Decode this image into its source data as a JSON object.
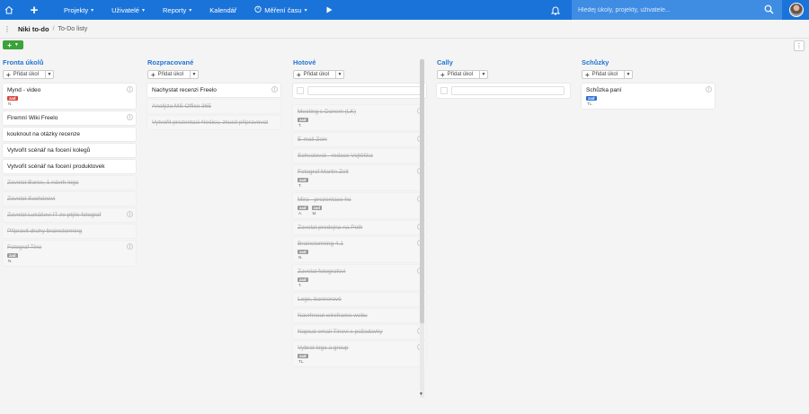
{
  "topbar": {
    "nav": [
      {
        "label": "Projekty",
        "dropdown": true
      },
      {
        "label": "Uživatelé",
        "dropdown": true
      },
      {
        "label": "Reporty",
        "dropdown": true
      },
      {
        "label": "Kalendář",
        "dropdown": false
      },
      {
        "label": "Měření času",
        "dropdown": true
      }
    ],
    "search_placeholder": "Hledej úkoly, projekty, uživatele..."
  },
  "breadcrumb": {
    "project": "Niki to-do",
    "separator": "/",
    "page": "To-Do listy"
  },
  "add_task_label": "Přidat úkol",
  "columns": [
    {
      "title": "Fronta úkolů",
      "cards": [
        {
          "text": "Mynd - video",
          "done": false,
          "info": true,
          "badges": [
            {
              "label": "zad",
              "color": "#d9433b",
              "num": "N."
            }
          ]
        },
        {
          "text": "Firemní Wiki Freelo",
          "done": false,
          "info": true,
          "badges": []
        },
        {
          "text": "kouknout na otázky recenze",
          "done": false,
          "info": false,
          "badges": []
        },
        {
          "text": "Vytvořit scénář na focení kolegů",
          "done": false,
          "info": false,
          "badges": []
        },
        {
          "text": "Vytvořit scénář na focení produktovek",
          "done": false,
          "info": false,
          "badges": []
        },
        {
          "text": "Zavolat Barce, 1 návrh loga",
          "done": true,
          "info": false,
          "badges": []
        },
        {
          "text": "Zavolat Suchánovi",
          "done": true,
          "info": false,
          "badges": []
        },
        {
          "text": "Zavolat Lukášovi IT ze ptýle fotograf",
          "done": true,
          "info": true,
          "badges": []
        },
        {
          "text": "Připravit druhy brainstorming",
          "done": true,
          "info": false,
          "badges": []
        },
        {
          "text": "Fotograf Tino",
          "done": true,
          "info": true,
          "badges": [
            {
              "label": "zad",
              "color": "#9a9a9a",
              "num": "N."
            }
          ]
        }
      ]
    },
    {
      "title": "Rozpracované",
      "cards": [
        {
          "text": "Nachystat recenzi Freelo",
          "done": false,
          "info": true,
          "badges": []
        },
        {
          "text": "Analýza MS Office 365",
          "done": true,
          "info": false,
          "badges": []
        },
        {
          "text": "Vytvořit prezentaci Nečisu, zkusit připravovat",
          "done": true,
          "info": false,
          "badges": []
        }
      ]
    },
    {
      "title": "Hotové",
      "ghost": true,
      "cards": [
        {
          "text": "Meeting s Danem (LK)",
          "done": true,
          "info": true,
          "badges": [
            {
              "label": "zad",
              "color": "#9a9a9a",
              "num": "T."
            }
          ]
        },
        {
          "text": "E-mail Zein",
          "done": true,
          "info": true,
          "badges": []
        },
        {
          "text": "Schvalovat - redace Vojtěška",
          "done": true,
          "info": false,
          "badges": []
        },
        {
          "text": "Fotograf Martin Zeit",
          "done": true,
          "info": true,
          "badges": [
            {
              "label": "zad",
              "color": "#9a9a9a",
              "num": "T."
            }
          ]
        },
        {
          "text": "Mira - prezentace ho",
          "done": true,
          "info": true,
          "badges": [
            {
              "label": "zad",
              "color": "#9a9a9a",
              "num": "A."
            },
            {
              "label": "zad",
              "color": "#9a9a9a",
              "num": "M."
            }
          ]
        },
        {
          "text": "Zavolat prodejna na Polh",
          "done": true,
          "info": true,
          "badges": []
        },
        {
          "text": "Brainstorming 4.1",
          "done": true,
          "info": true,
          "badges": [
            {
              "label": "zad",
              "color": "#9a9a9a",
              "num": "N."
            }
          ]
        },
        {
          "text": "Zavolat fotografovi",
          "done": true,
          "info": true,
          "badges": [
            {
              "label": "zad",
              "color": "#9a9a9a",
              "num": "T."
            }
          ]
        },
        {
          "text": "Logo, bannerové",
          "done": true,
          "info": false,
          "badges": []
        },
        {
          "text": "Navrhnout wireframe webu",
          "done": true,
          "info": false,
          "badges": []
        },
        {
          "text": "Napsat email Tinovi s požadavky",
          "done": true,
          "info": true,
          "badges": []
        },
        {
          "text": "Vybrat loga a group",
          "done": true,
          "info": true,
          "badges": [
            {
              "label": "zad",
              "color": "#9a9a9a",
              "num": "TL."
            }
          ]
        }
      ]
    },
    {
      "title": "Cally",
      "ghost": true,
      "cards": []
    },
    {
      "title": "Schůzky",
      "cards": [
        {
          "text": "Schůzka paní",
          "done": false,
          "info": true,
          "badges": [
            {
              "label": "zad",
              "color": "#2b6fd0",
              "num": "TL."
            }
          ]
        }
      ]
    }
  ]
}
